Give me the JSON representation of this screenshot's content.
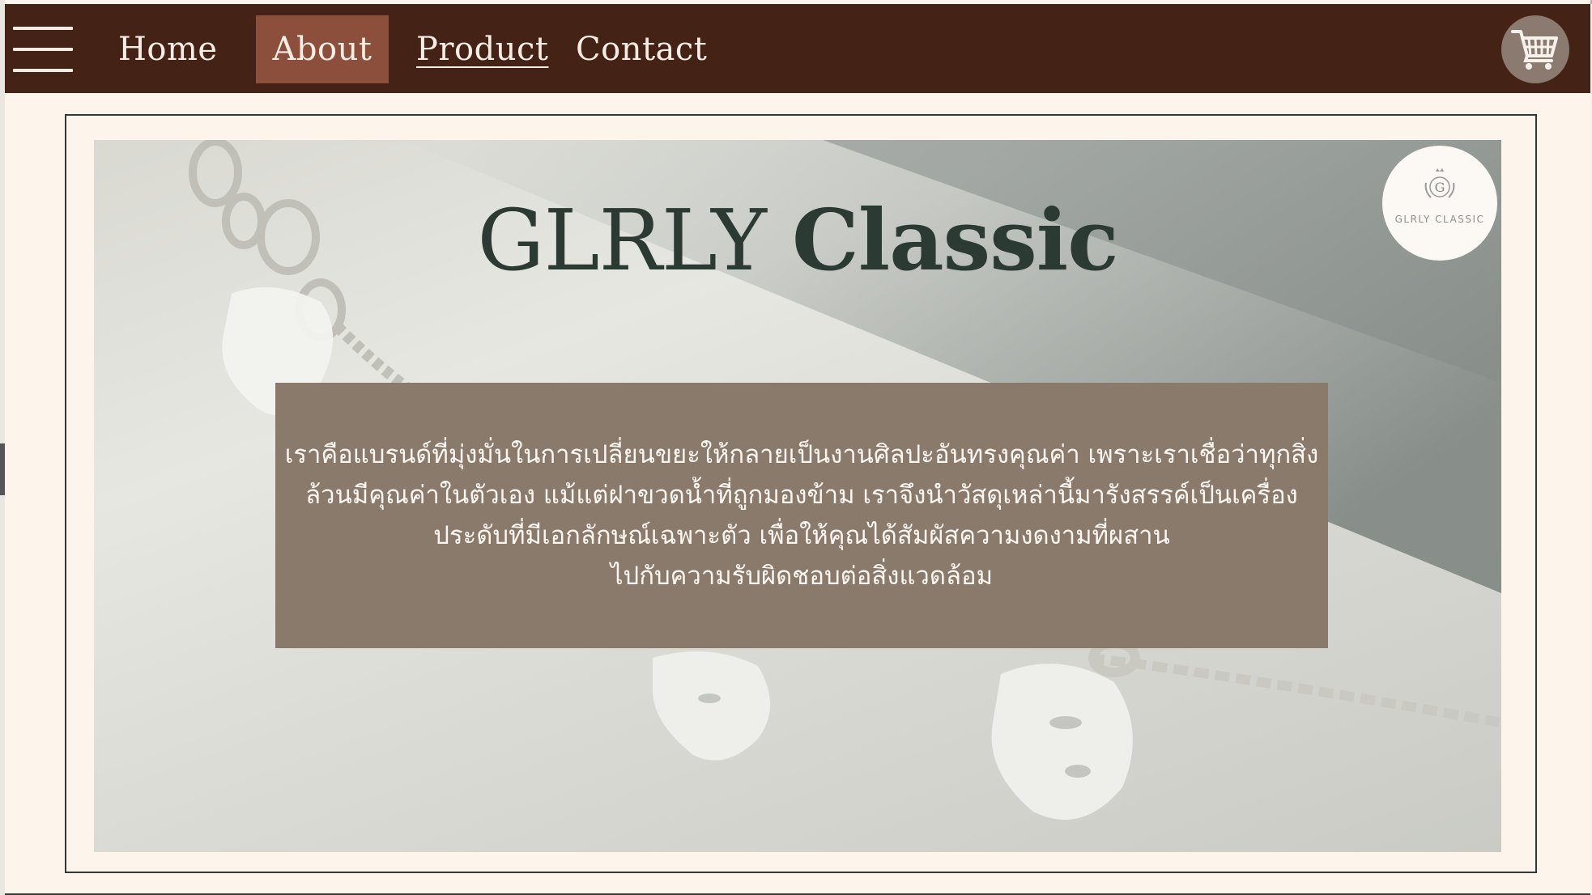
{
  "nav": {
    "items": [
      {
        "label": "Home"
      },
      {
        "label": "About"
      },
      {
        "label": "Product"
      },
      {
        "label": "Contact"
      }
    ],
    "active": "About",
    "menu_icon": "hamburger-menu-icon",
    "cart_icon": "shopping-cart-icon"
  },
  "hero": {
    "title_part1": "GLRLY",
    "title_part2": "Classic",
    "logo_text": "GLRLY CLASSIC",
    "logo_monogram": "G",
    "about_lines": [
      "เราคือแบรนด์ที่มุ่งมั่นในการเปลี่ยนขยะให้กลายเป็นงานศิลปะอันทรงคุณค่า เพราะเราเชื่อว่าทุกสิ่ง",
      "ล้วนมีคุณค่าในตัวเอง แม้แต่ฝาขวดน้ำที่ถูกมองข้าม เราจึงนำวัสดุเหล่านี้มารังสรรค์เป็นเครื่อง",
      "ประดับที่มีเอกลักษณ์เฉพาะตัว เพื่อให้คุณได้สัมผัสความงดงามที่ผสาน",
      "ไปกับความรับผิดชอบต่อสิ่งแวดล้อม"
    ]
  },
  "colors": {
    "nav_bg": "#442316",
    "nav_active_bg": "#8b4f3c",
    "page_bg": "#fdf5ec",
    "about_box_bg": "#8a7a6c",
    "title_color": "#2c3a34"
  }
}
